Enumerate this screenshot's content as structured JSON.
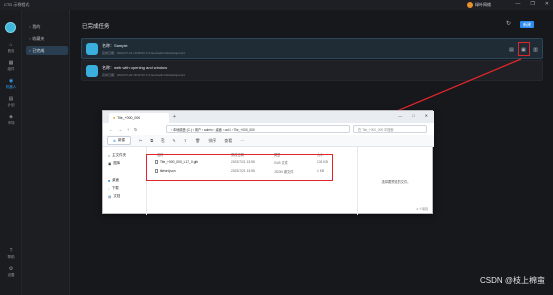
{
  "titlebar": {
    "title": "CTD 示例程式",
    "user": "绿叶网络",
    "min": "—",
    "max": "❐",
    "close": "✕"
  },
  "rail": [
    {
      "icon": "home-icon",
      "glyph": "⌂",
      "label": "首页"
    },
    {
      "icon": "grid-icon",
      "glyph": "▦",
      "label": "组件"
    },
    {
      "icon": "robot-icon",
      "glyph": "◉",
      "label": "机器人"
    },
    {
      "icon": "calendar-icon",
      "glyph": "▤",
      "label": "计划"
    },
    {
      "icon": "market-icon",
      "glyph": "◈",
      "label": "市场"
    },
    {
      "icon": "help-icon",
      "glyph": "?",
      "label": "帮助"
    },
    {
      "icon": "settings-icon",
      "glyph": "⚙",
      "label": "设置"
    }
  ],
  "sidebar": [
    {
      "label": "我的"
    },
    {
      "label": "收藏夹"
    },
    {
      "label": "已完成"
    }
  ],
  "main": {
    "title": "已完成任务",
    "new_label": "新建",
    "tasks": [
      {
        "name": "名称：Sample",
        "meta": "完成日期：2023-07-21 10:08:00   C:\\Users\\admin\\Desktop\\out1"
      },
      {
        "name": "名称：web with opening and window",
        "meta": "完成日期：2023-07-20 18:32:00   C:\\Users\\admin\\Desktop\\out1"
      }
    ]
  },
  "explorer": {
    "tab": "Tile_+000_000",
    "address": "›  本地磁盘 (C:)  ›  用户  ›  admin  ›  桌面  ›  out1  ›  Tile_+000_000",
    "search": "在 Tile_+000_000 中搜索",
    "new_label": "新建",
    "commands": [
      "✂",
      "⧉",
      "⎘",
      "✎",
      "⇪",
      "🗑",
      "排序",
      "查看",
      "···"
    ],
    "nav": [
      "主文件夹",
      "图库",
      "桌面",
      "下载",
      "文档"
    ],
    "columns": [
      "名称",
      "修改日期",
      "类型",
      "大小"
    ],
    "files": [
      {
        "name": "Tile_+000_000_L17_0.glb",
        "date": "2023/7/21 13:55",
        "type": "GLB 文件",
        "size": "131 KB"
      },
      {
        "name": "tileset.json",
        "date": "2023/7/21 13:55",
        "type": "JSON 源文件",
        "size": "1 KB"
      }
    ],
    "preview": "选择要预览的文件。",
    "status": "2 个项目"
  },
  "watermark": "CSDN @枝上棉蛮",
  "colors": {
    "accent": "#2d8cf0",
    "highlight": "#e0262b"
  }
}
